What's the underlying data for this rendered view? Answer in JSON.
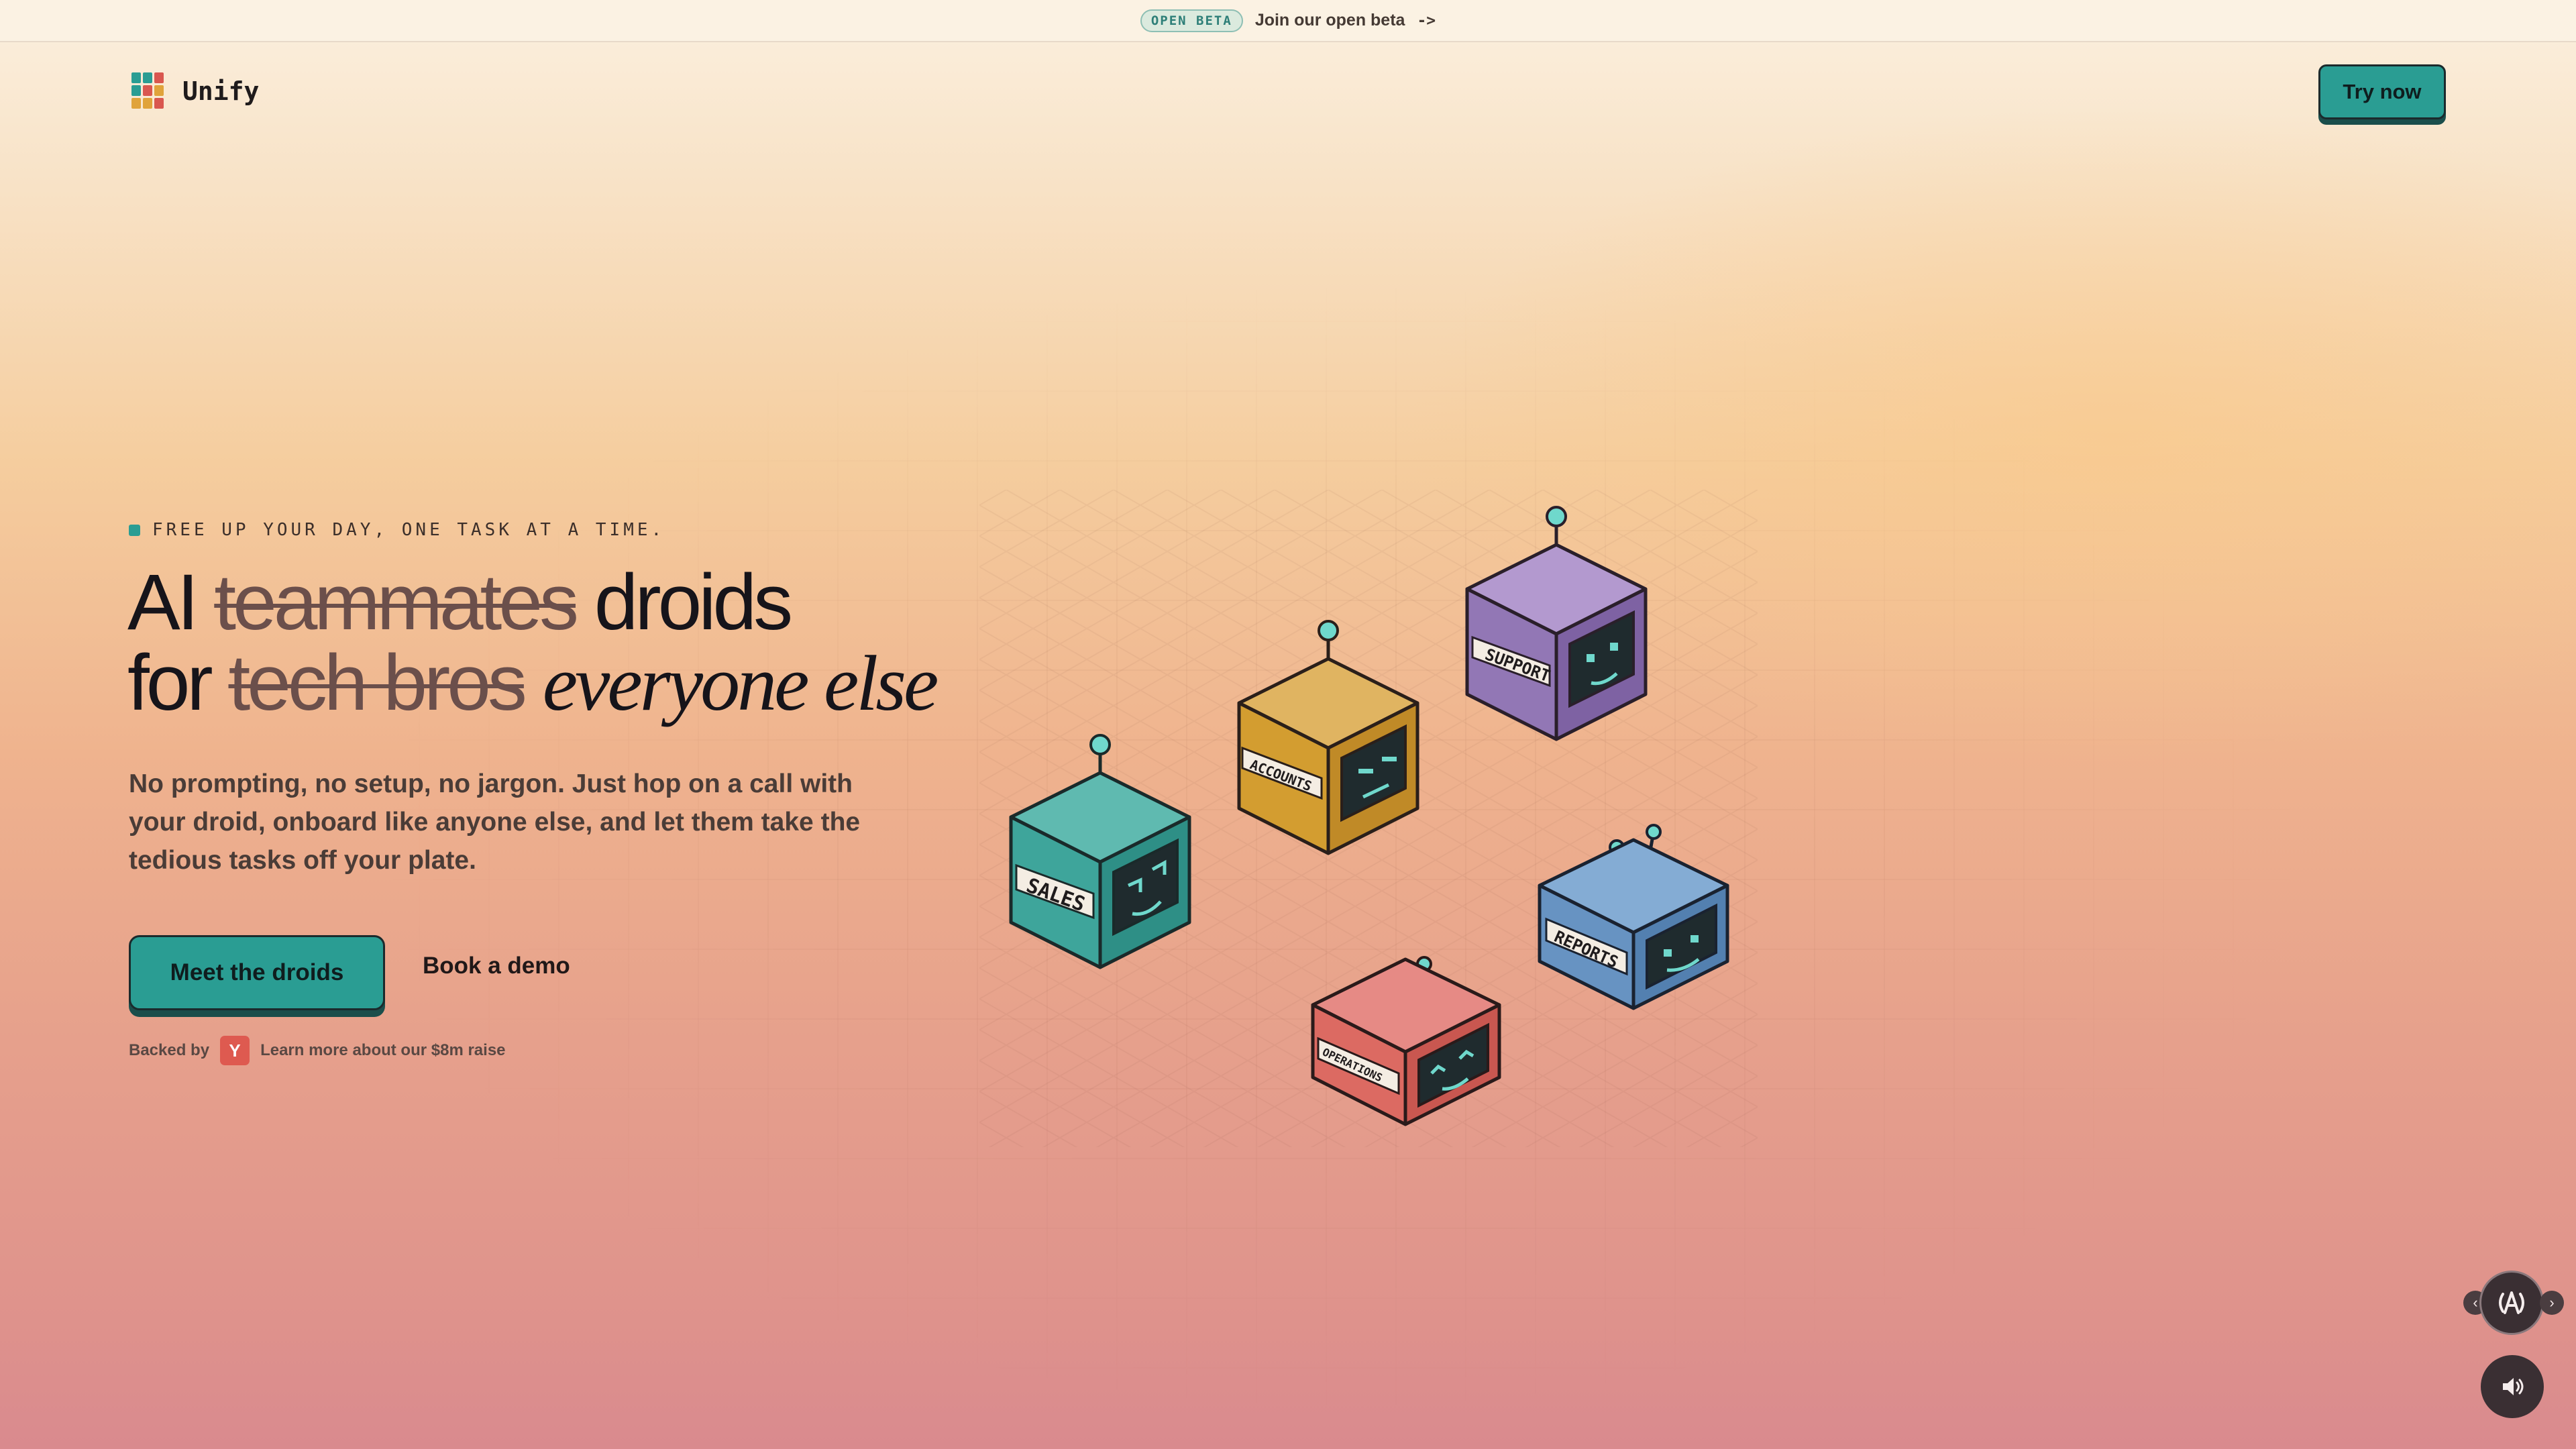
{
  "announcement": {
    "badge": "OPEN BETA",
    "text": "Join our open beta",
    "arrow": "->"
  },
  "nav": {
    "brand": "Unify",
    "cta_label": "Try now",
    "logo_colors": [
      "#2a9d93",
      "#e0a33b",
      "#d9574f"
    ]
  },
  "hero": {
    "eyebrow": "FREE UP YOUR DAY, ONE TASK AT A TIME.",
    "headline": {
      "line1_prefix": "AI",
      "line1_strike": "teammates",
      "line1_suffix": "droids",
      "line2_prefix": "for",
      "line2_strike": "tech bros",
      "line2_script": "everyone else"
    },
    "subtext": "No prompting, no setup, no jargon. Just hop on a call with your droid, onboard like anyone else, and let them take the tedious tasks off your plate.",
    "primary_cta": "Meet the droids",
    "secondary_cta": "Book a demo",
    "backed_by": "Backed by",
    "investor_badge": "Y",
    "raise_link": "Learn more about our $8m raise"
  },
  "droids": [
    {
      "label": "SALES",
      "color": "#3fa79e",
      "accent": "teal"
    },
    {
      "label": "ACCOUNTS",
      "color": "#d6a43c",
      "accent": "mustard"
    },
    {
      "label": "SUPPORT",
      "color": "#9a7bb8",
      "accent": "purple"
    },
    {
      "label": "REPORTS",
      "color": "#6b98c6",
      "accent": "blue"
    },
    {
      "label": "OPERATIONS",
      "color": "#dd6a63",
      "accent": "red"
    }
  ],
  "controls": {
    "prev_icon": "chevron-left-icon",
    "next_icon": "chevron-right-icon",
    "voice_icon": "voice-agent-icon",
    "sound_icon": "speaker-icon",
    "prev_glyph": "‹",
    "next_glyph": "›"
  }
}
